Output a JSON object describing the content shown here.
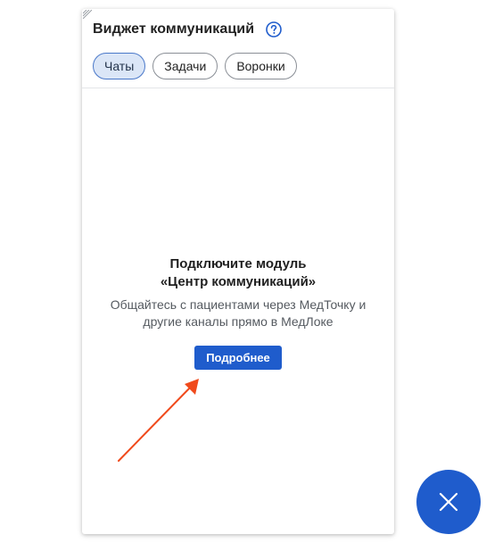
{
  "widget": {
    "title": "Виджет коммуникаций",
    "help_icon": "question-circle-icon",
    "tabs": [
      {
        "label": "Чаты",
        "active": true
      },
      {
        "label": "Задачи",
        "active": false
      },
      {
        "label": "Воронки",
        "active": false
      }
    ],
    "empty_state": {
      "title_line1": "Подключите модуль",
      "title_line2": "«Центр коммуникаций»",
      "text_line1": "Общайтесь с пациентами через МедТочку и",
      "text_line2": "другие каналы прямо в МедЛоке",
      "button_label": "Подробнее"
    }
  },
  "fab": {
    "icon": "close-icon"
  },
  "colors": {
    "accent": "#1f5ccc",
    "tab_active_bg": "#dbe6f7",
    "annotation_arrow": "#f04a1c"
  }
}
